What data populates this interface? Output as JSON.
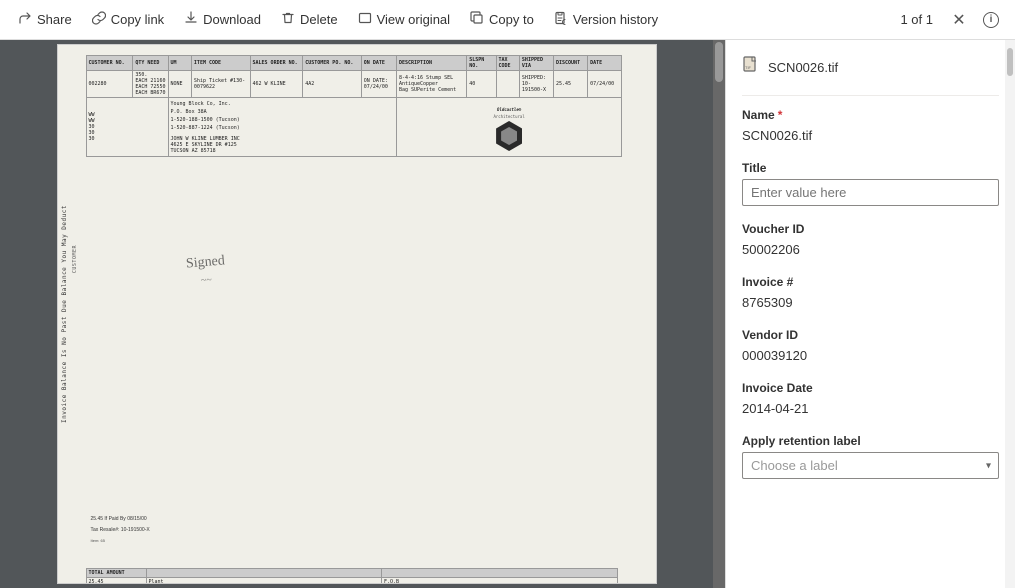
{
  "toolbar": {
    "share_label": "Share",
    "copy_link_label": "Copy link",
    "download_label": "Download",
    "delete_label": "Delete",
    "view_original_label": "View original",
    "copy_to_label": "Copy to",
    "version_history_label": "Version history",
    "page_indicator": "1 of 1"
  },
  "document": {
    "filename": "SCN0026.tif",
    "page_content_note": "Scanned invoice document"
  },
  "right_panel": {
    "file_name": "SCN0026.tif",
    "fields": {
      "name_label": "Name",
      "name_required": "*",
      "name_value": "SCN0026.tif",
      "title_label": "Title",
      "title_placeholder": "Enter value here",
      "voucher_id_label": "Voucher ID",
      "voucher_id_value": "50002206",
      "invoice_num_label": "Invoice #",
      "invoice_num_value": "8765309",
      "vendor_id_label": "Vendor ID",
      "vendor_id_value": "000039120",
      "invoice_date_label": "Invoice Date",
      "invoice_date_value": "2014-04-21",
      "retention_label": "Apply retention label",
      "retention_placeholder": "Choose a label"
    }
  },
  "icons": {
    "share": "↑",
    "copy_link": "🔗",
    "download": "⬇",
    "delete": "🗑",
    "view_original": "⬜",
    "copy_to": "⧉",
    "version_history": "🕐",
    "close": "✕",
    "info": "ℹ",
    "file_tif": "🖼",
    "chevron_down": "❯"
  }
}
